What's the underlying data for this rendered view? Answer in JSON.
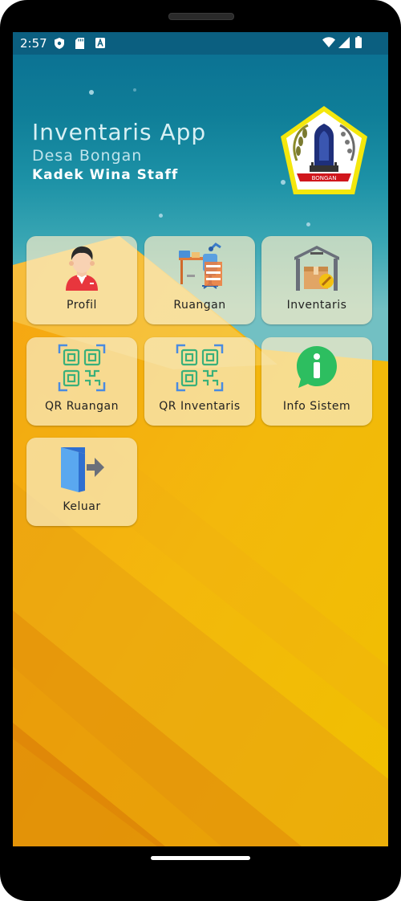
{
  "status_bar": {
    "time": "2:57"
  },
  "header": {
    "title": "Inventaris App",
    "subtitle": "Desa Bongan",
    "user": "Kadek Wina Staff"
  },
  "logo": {
    "text": "BONGAN"
  },
  "menu": [
    {
      "label": "Profil",
      "icon": "person-icon"
    },
    {
      "label": "Ruangan",
      "icon": "room-icon"
    },
    {
      "label": "Inventaris",
      "icon": "warehouse-icon"
    },
    {
      "label": "QR Ruangan",
      "icon": "qr-code-icon"
    },
    {
      "label": "QR Inventaris",
      "icon": "qr-code-icon"
    },
    {
      "label": "Info Sistem",
      "icon": "info-icon"
    },
    {
      "label": "Keluar",
      "icon": "logout-icon"
    }
  ],
  "colors": {
    "header_bg": "#0a6e92",
    "card_bg": "#f8ecc8",
    "orange": "#f0a018",
    "yellow": "#f2c200"
  }
}
